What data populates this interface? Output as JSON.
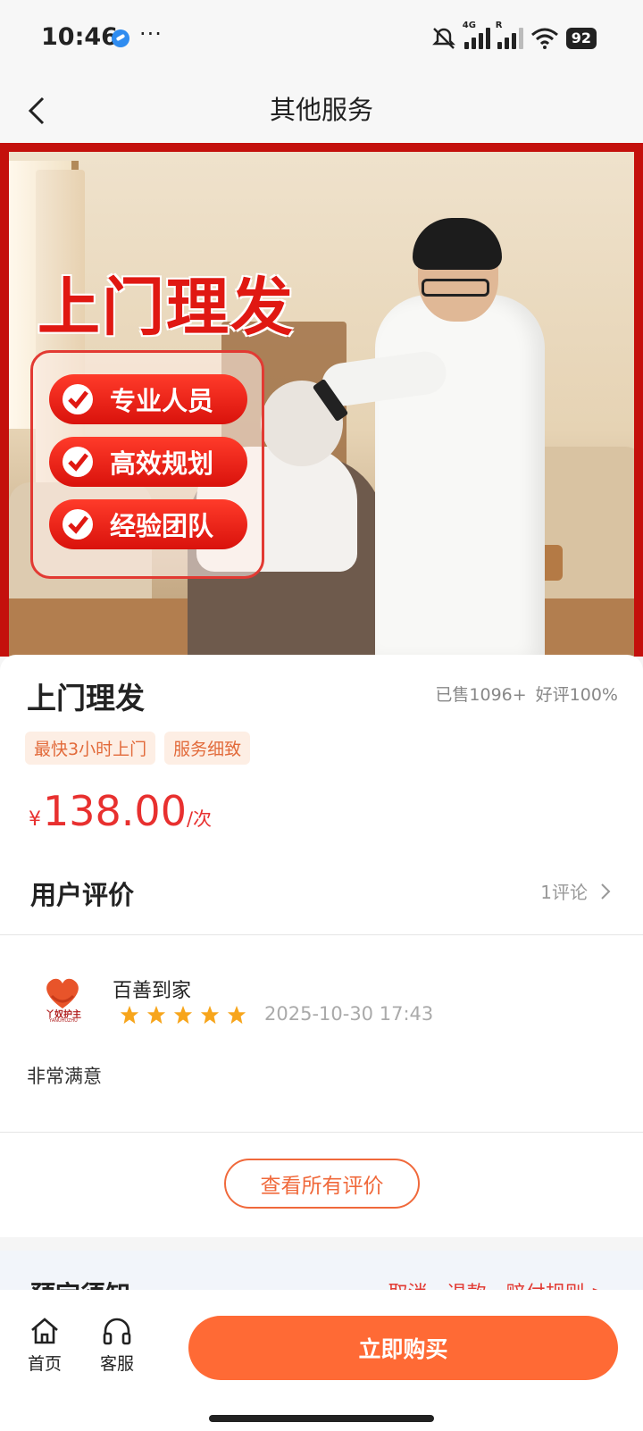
{
  "status_bar": {
    "time": "10:46",
    "network_4g": "4G",
    "roaming": "R",
    "battery": "92"
  },
  "navbar": {
    "title": "其他服务"
  },
  "banner": {
    "headline": "上门理发",
    "badges": [
      "专业人员",
      "高效规划",
      "经验团队"
    ]
  },
  "product": {
    "title": "上门理发",
    "sold": "已售1096+",
    "rating": "好评100%",
    "tags": [
      "最快3小时上门",
      "服务细致"
    ],
    "price_currency": "¥",
    "price_value": "138.00",
    "price_unit": "/次"
  },
  "reviews": {
    "section_title": "用户评价",
    "count_label": "1评论",
    "items": [
      {
        "user": "百善到家",
        "avatar_brand": "丫奴护主",
        "avatar_brand_en": "YANUHUZHU",
        "stars": 5,
        "date": "2025-10-30 17:43",
        "text": "非常满意"
      }
    ],
    "view_all_label": "查看所有评价"
  },
  "notice": {
    "title": "预定须知",
    "links": "取消、退款、赔付规则 >"
  },
  "bottom_bar": {
    "home_label": "首页",
    "service_label": "客服",
    "buy_label": "立即购买"
  },
  "colors": {
    "accent": "#ff6a35",
    "price": "#e8302f",
    "banner_red": "#c4100c",
    "star": "#f7a51c"
  }
}
